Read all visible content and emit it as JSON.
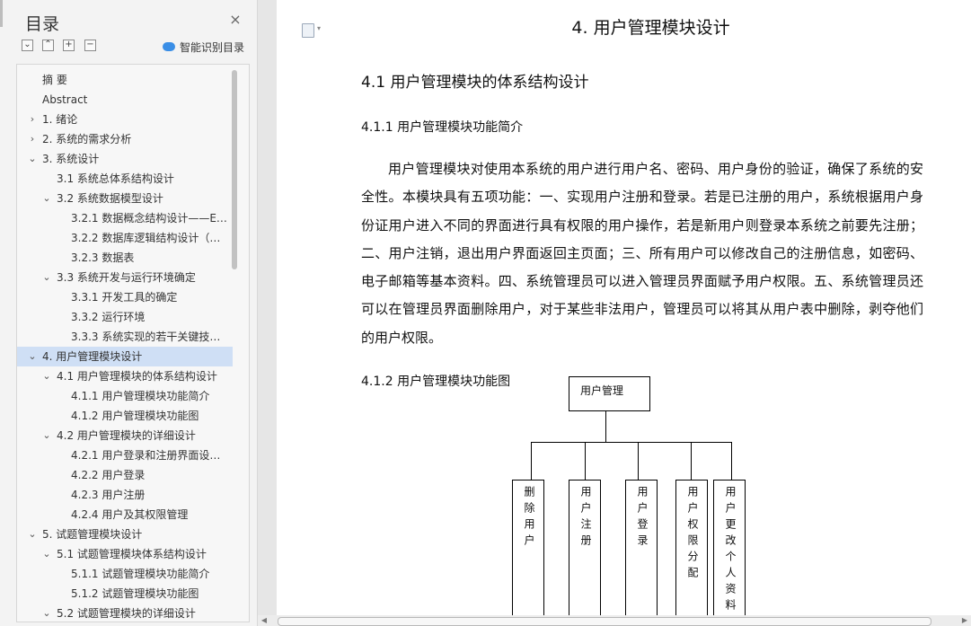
{
  "sidebar": {
    "title": "目录",
    "close_glyph": "×",
    "tools": [
      "⌄",
      "⌃",
      "+",
      "−"
    ],
    "smart_toc_label": "智能识别目录",
    "items": [
      {
        "label": "摘    要",
        "level": 0,
        "arrow": ""
      },
      {
        "label": "Abstract",
        "level": 0,
        "arrow": ""
      },
      {
        "label": "1. 绪论",
        "level": 0,
        "arrow": "›"
      },
      {
        "label": "2. 系统的需求分析",
        "level": 0,
        "arrow": "›"
      },
      {
        "label": "3. 系统设计",
        "level": 0,
        "arrow": "⌄"
      },
      {
        "label": "3.1 系统总体系结构设计",
        "level": 1,
        "arrow": ""
      },
      {
        "label": "3.2  系统数据模型设计",
        "level": 1,
        "arrow": "⌄"
      },
      {
        "label": "3.2.1  数据概念结构设计——E…",
        "level": 2,
        "arrow": ""
      },
      {
        "label": "3.2.2  数据库逻辑结构设计（…",
        "level": 2,
        "arrow": ""
      },
      {
        "label": "3.2.3  数据表",
        "level": 2,
        "arrow": ""
      },
      {
        "label": "3.3  系统开发与运行环境确定",
        "level": 1,
        "arrow": "⌄"
      },
      {
        "label": "3.3.1  开发工具的确定",
        "level": 2,
        "arrow": ""
      },
      {
        "label": "3.3.2  运行环境",
        "level": 2,
        "arrow": ""
      },
      {
        "label": "3.3.3 系统实现的若干关键技…",
        "level": 2,
        "arrow": ""
      },
      {
        "label": "4.  用户管理模块设计",
        "level": 0,
        "arrow": "⌄",
        "selected": true
      },
      {
        "label": "4.1 用户管理模块的体系结构设计",
        "level": 1,
        "arrow": "⌄"
      },
      {
        "label": "4.1.1  用户管理模块功能简介",
        "level": 2,
        "arrow": ""
      },
      {
        "label": "4.1.2  用户管理模块功能图",
        "level": 2,
        "arrow": ""
      },
      {
        "label": "4.2  用户管理模块的详细设计",
        "level": 1,
        "arrow": "⌄"
      },
      {
        "label": "4.2.1  用户登录和注册界面设…",
        "level": 2,
        "arrow": ""
      },
      {
        "label": "4.2.2  用户登录",
        "level": 2,
        "arrow": ""
      },
      {
        "label": "4.2.3  用户注册",
        "level": 2,
        "arrow": ""
      },
      {
        "label": "4.2.4  用户及其权限管理",
        "level": 2,
        "arrow": ""
      },
      {
        "label": "5.  试题管理模块设计",
        "level": 0,
        "arrow": "⌄"
      },
      {
        "label": "5.1  试题管理模块体系结构设计",
        "level": 1,
        "arrow": "⌄"
      },
      {
        "label": "5.1.1  试题管理模块功能简介",
        "level": 2,
        "arrow": ""
      },
      {
        "label": "5.1.2  试题管理模块功能图",
        "level": 2,
        "arrow": ""
      },
      {
        "label": "5.2  试题管理模块的详细设计",
        "level": 1,
        "arrow": "⌄"
      }
    ]
  },
  "document": {
    "chapter_title": "4.  用户管理模块设计",
    "h2": "4.1 用户管理模块的体系结构设计",
    "h3a": "4.1.1  用户管理模块功能简介",
    "paragraph": "用户管理模块对使用本系统的用户进行用户名、密码、用户身份的验证，确保了系统的安全性。本模块具有五项功能：一、实现用户注册和登录。若是已注册的用户，系统根据用户身份证用户进入不同的界面进行具有权限的用户操作，若是新用户则登录本系统之前要先注册；二、用户注销，退出用户界面返回主页面；三、所有用户可以修改自己的注册信息，如密码、电子邮箱等基本资料。四、系统管理员可以进入管理员界面赋予用户权限。五、系统管理员还可以在管理员界面删除用户，对于某些非法用户，管理员可以将其从用户表中删除，剥夺他们的用户权限。",
    "h3b": "4.1.2  用户管理模块功能图",
    "diagram": {
      "root": "用户管理",
      "children": [
        "删除用户",
        "用户注册",
        "用户登录",
        "用户权限分配",
        "用户更改个人资料"
      ]
    }
  }
}
